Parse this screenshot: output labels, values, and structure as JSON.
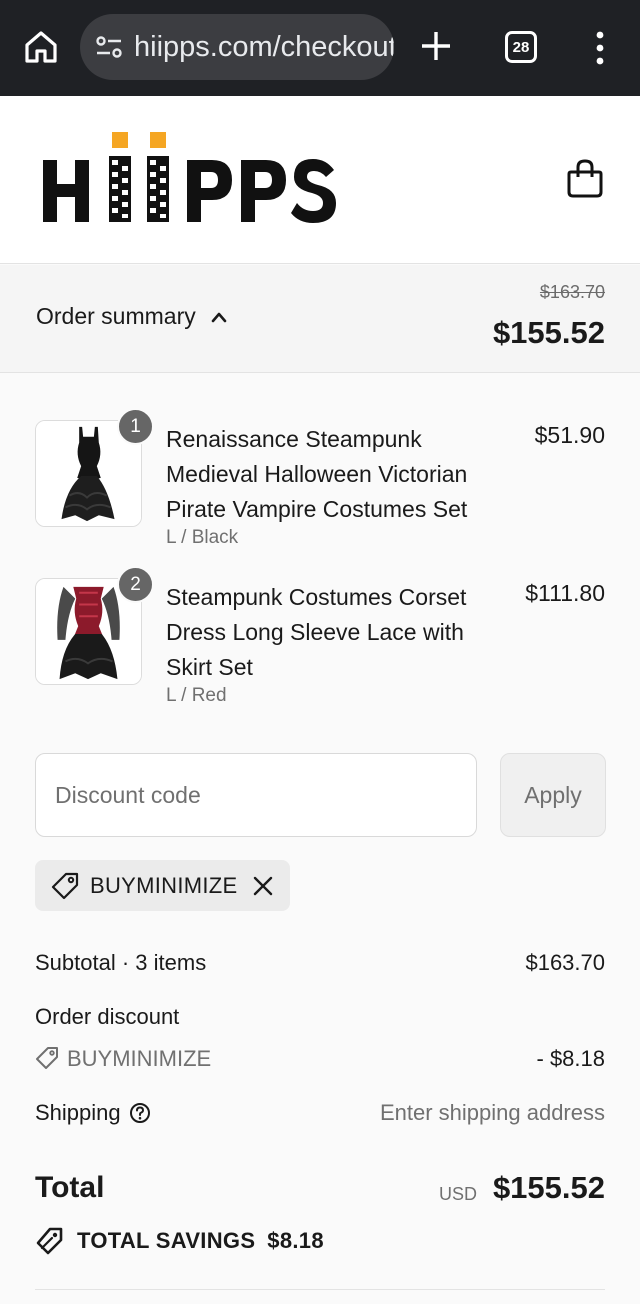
{
  "browser": {
    "url": "hiipps.com/checkout",
    "tab_count": "28"
  },
  "header": {
    "logo_text": "HIIPPS",
    "colors": {
      "logo_accent": "#f5a623",
      "logo_text": "#111111"
    }
  },
  "summary": {
    "toggle_label": "Order summary",
    "original_total": "$163.70",
    "total": "$155.52"
  },
  "items": [
    {
      "quantity": "1",
      "title": "Renaissance Steampunk Medieval Halloween Victorian Pirate Vampire Costumes Set",
      "variant": "L / Black",
      "price": "$51.90"
    },
    {
      "quantity": "2",
      "title": "Steampunk Costumes Corset Dress Long Sleeve Lace with Skirt Set",
      "variant": "L / Red",
      "price": "$111.80"
    }
  ],
  "discount": {
    "placeholder": "Discount code",
    "apply_label": "Apply",
    "applied_code": "BUYMINIMIZE"
  },
  "totals": {
    "subtotal_label": "Subtotal · 3 items",
    "subtotal_value": "$163.70",
    "order_discount_label": "Order discount",
    "discount_code": "BUYMINIMIZE",
    "discount_value": "- $8.18",
    "shipping_label": "Shipping",
    "shipping_value": "Enter shipping address",
    "total_label": "Total",
    "currency": "USD",
    "total_value": "$155.52",
    "savings_label": "TOTAL SAVINGS",
    "savings_value": "$8.18"
  },
  "icons": [
    "home-icon",
    "site-settings-icon",
    "new-tab-icon",
    "tabs-icon",
    "more-options-icon",
    "shopping-bag-icon",
    "chevron-up-icon",
    "tag-icon",
    "close-icon",
    "help-icon",
    "savings-tag-icon"
  ]
}
